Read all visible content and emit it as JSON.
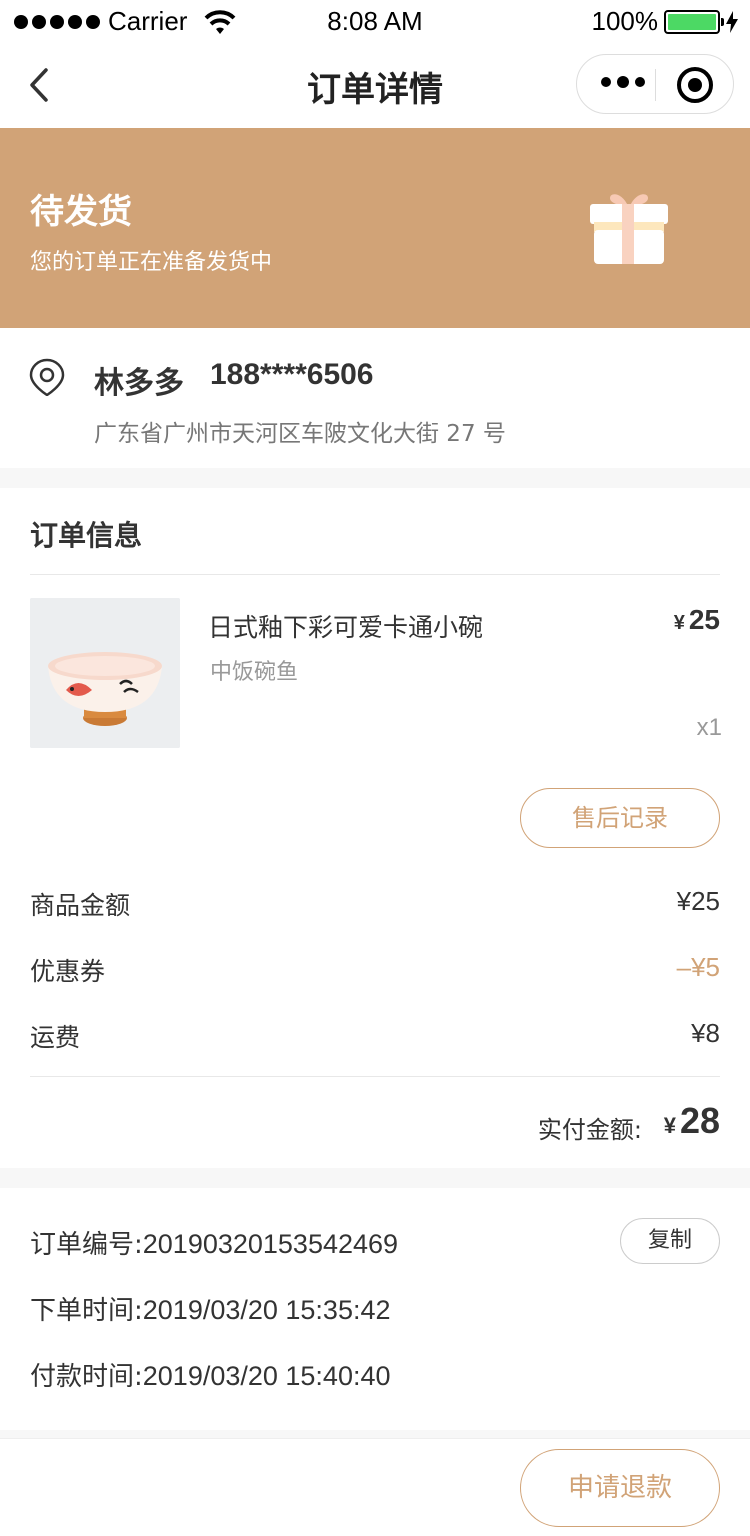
{
  "status_bar": {
    "carrier": "Carrier",
    "time": "8:08 AM",
    "battery": "100%",
    "battery_color": "#4cd964"
  },
  "nav": {
    "title": "订单详情",
    "back_icon": "chevron-left-icon",
    "more_icon": "more-dots-icon",
    "close_icon": "target-circle-icon"
  },
  "banner": {
    "title": "待发货",
    "subtitle": "您的订单正在准备发货中",
    "icon": "gift-icon",
    "background": "#d1a377"
  },
  "address": {
    "name": "林多多",
    "phone": "188****6506",
    "detail": "广东省广州市天河区车陂文化大街 27 号",
    "icon": "location-pin-icon"
  },
  "order": {
    "section_title": "订单信息",
    "product": {
      "name": "日式釉下彩可爱卡通小碗",
      "spec": "中饭碗鱼",
      "currency": "¥",
      "price": "25",
      "qty": "x1"
    },
    "aftersale_label": "售后记录",
    "fees": [
      {
        "label": "商品金额",
        "value": "¥25"
      },
      {
        "label": "优惠券",
        "value": "–¥5"
      },
      {
        "label": "运费",
        "value": "¥8"
      }
    ],
    "total_label": "实付金额:",
    "total_currency": "¥",
    "total_value": "28"
  },
  "meta": {
    "order_no_label": "订单编号:",
    "order_no": "20190320153542469",
    "copy_label": "复制",
    "order_time_label": "下单时间:",
    "order_time": "2019/03/20 15:35:42",
    "pay_time_label": "付款时间:",
    "pay_time": "2019/03/20 15:40:40"
  },
  "bottom": {
    "refund_label": "申请退款"
  },
  "colors": {
    "accent": "#d1a377",
    "discount": "#d1a377"
  }
}
